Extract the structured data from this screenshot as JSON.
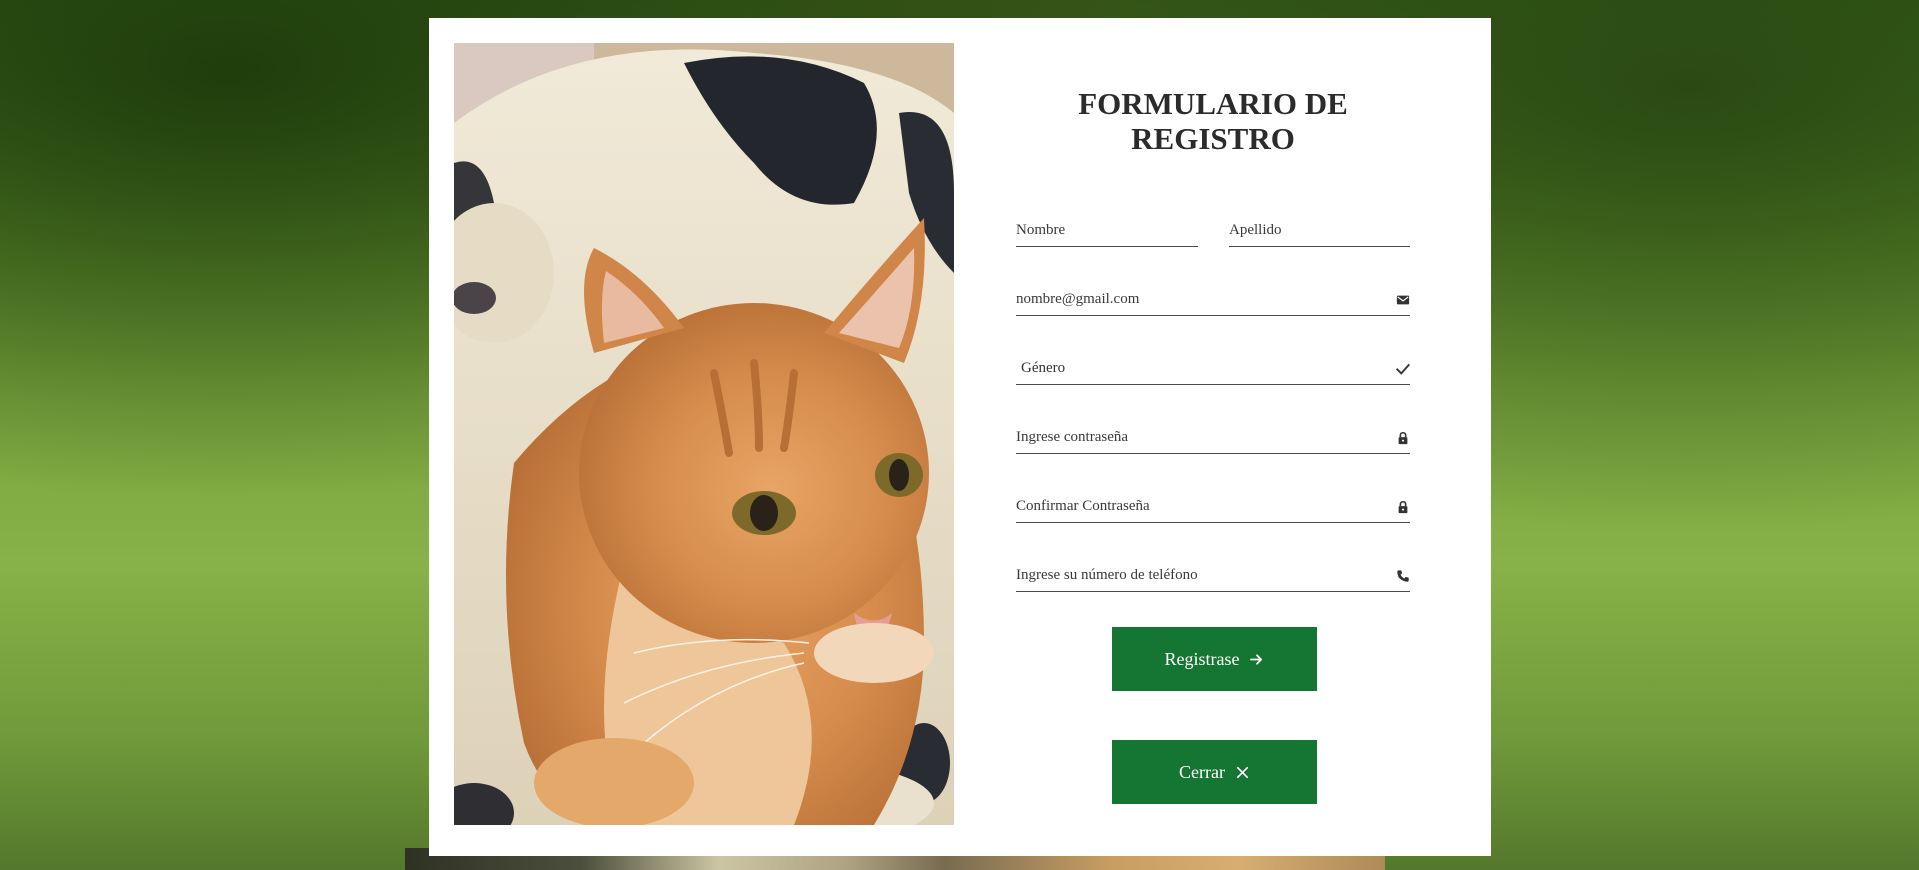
{
  "form": {
    "title_line1": "FORMULARIO DE",
    "title_line2": "REGISTRO",
    "first_name": {
      "placeholder": "Nombre",
      "value": ""
    },
    "last_name": {
      "placeholder": "Apellido",
      "value": ""
    },
    "email": {
      "placeholder": "nombre@gmail.com",
      "value": "",
      "icon": "mail-icon"
    },
    "gender": {
      "selected": "Género",
      "icon": "check-icon"
    },
    "password": {
      "placeholder": "Ingrese contraseña",
      "value": "",
      "icon": "lock-icon"
    },
    "confirm_password": {
      "placeholder": "Confirmar Contraseña",
      "value": "",
      "icon": "lock-icon"
    },
    "phone": {
      "placeholder": "Ingrese su número de teléfono",
      "value": "",
      "icon": "phone-icon"
    },
    "register_button": {
      "label": "Registrase",
      "icon": "arrow-right-icon"
    },
    "close_button": {
      "label": "Cerrar",
      "icon": "close-icon"
    }
  },
  "colors": {
    "button_bg": "#157532",
    "button_text": "#ffffff",
    "title": "#2b2b2b",
    "card_bg": "#ffffff"
  },
  "images": {
    "hero": "cat-and-dog-photo",
    "background": "grass-background-photo"
  }
}
